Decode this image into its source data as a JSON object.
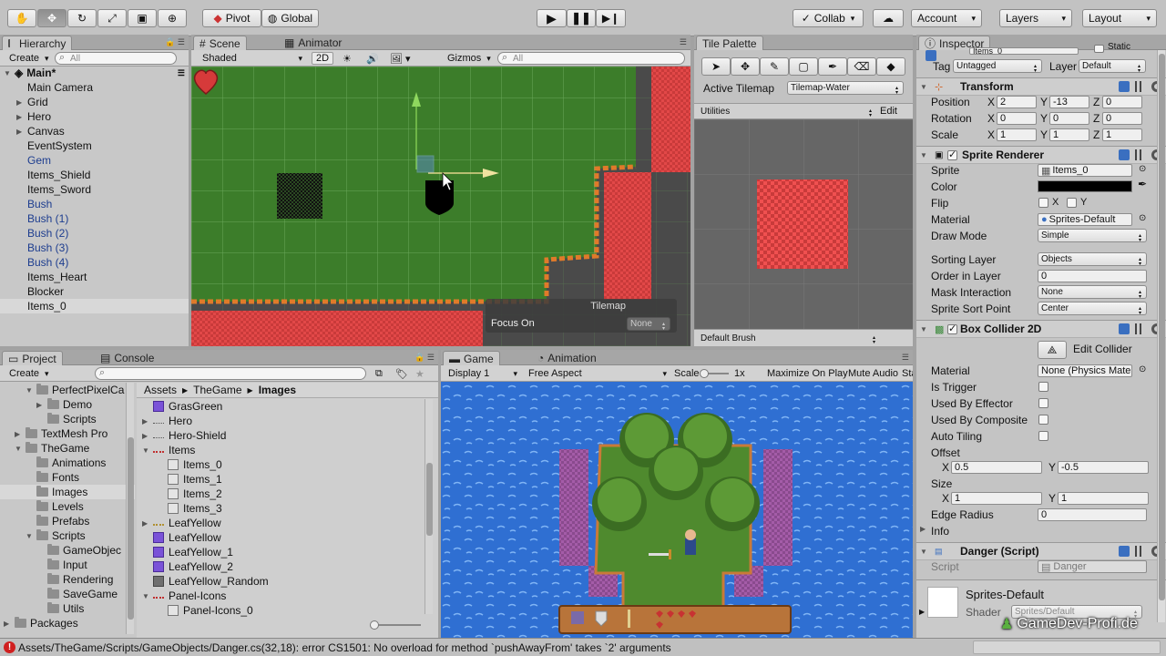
{
  "toolbar": {
    "pivot": "Pivot",
    "global": "Global",
    "collab": "Collab",
    "account": "Account",
    "layers": "Layers",
    "layout": "Layout"
  },
  "hierarchy": {
    "tab": "Hierarchy",
    "create": "Create",
    "search_placeholder": "All",
    "scene": "Main*",
    "items": [
      {
        "label": "Main Camera",
        "arrow": "",
        "color": "normal"
      },
      {
        "label": "Grid",
        "arrow": "▶",
        "color": "normal"
      },
      {
        "label": "Hero",
        "arrow": "▶",
        "color": "normal"
      },
      {
        "label": "Canvas",
        "arrow": "▶",
        "color": "normal"
      },
      {
        "label": "EventSystem",
        "arrow": "",
        "color": "normal"
      },
      {
        "label": "Gem",
        "arrow": "",
        "color": "blue"
      },
      {
        "label": "Items_Shield",
        "arrow": "",
        "color": "normal"
      },
      {
        "label": "Items_Sword",
        "arrow": "",
        "color": "normal"
      },
      {
        "label": "Bush",
        "arrow": "",
        "color": "blue"
      },
      {
        "label": "Bush (1)",
        "arrow": "",
        "color": "blue"
      },
      {
        "label": "Bush (2)",
        "arrow": "",
        "color": "blue"
      },
      {
        "label": "Bush (3)",
        "arrow": "",
        "color": "blue"
      },
      {
        "label": "Bush (4)",
        "arrow": "",
        "color": "blue"
      },
      {
        "label": "Items_Heart",
        "arrow": "",
        "color": "normal"
      },
      {
        "label": "Blocker",
        "arrow": "",
        "color": "normal"
      },
      {
        "label": "Items_0",
        "arrow": "",
        "color": "normal"
      }
    ]
  },
  "scene": {
    "tab_scene": "Scene",
    "tab_animator": "Animator",
    "shading": "Shaded",
    "mode_2d": "2D",
    "gizmos": "Gizmos",
    "search_placeholder": "All",
    "overlay_title": "Tilemap",
    "overlay_focus_label": "Focus On",
    "overlay_focus_value": "None"
  },
  "tile_palette": {
    "tab": "Tile Palette",
    "active_tilemap_label": "Active Tilemap",
    "active_tilemap_value": "Tilemap-Water",
    "palette": "Utilities",
    "edit": "Edit",
    "brush": "Default Brush"
  },
  "inspector": {
    "tab": "Inspector",
    "object_name": "Items_0",
    "static": "Static",
    "tag_label": "Tag",
    "tag_value": "Untagged",
    "layer_label": "Layer",
    "layer_value": "Default",
    "transform": {
      "title": "Transform",
      "position_label": "Position",
      "position": [
        "2",
        "-13",
        "0"
      ],
      "rotation_label": "Rotation",
      "rotation": [
        "0",
        "0",
        "0"
      ],
      "scale_label": "Scale",
      "scale": [
        "1",
        "1",
        "1"
      ]
    },
    "sprite_renderer": {
      "title": "Sprite Renderer",
      "sprite_label": "Sprite",
      "sprite_value": "Items_0",
      "color_label": "Color",
      "color_value": "#000000",
      "flip_label": "Flip",
      "flip_x": "X",
      "flip_y": "Y",
      "material_label": "Material",
      "material_value": "Sprites-Default",
      "draw_mode_label": "Draw Mode",
      "draw_mode_value": "Simple",
      "sorting_layer_label": "Sorting Layer",
      "sorting_layer_value": "Objects",
      "order_label": "Order in Layer",
      "order_value": "0",
      "mask_label": "Mask Interaction",
      "mask_value": "None",
      "sort_point_label": "Sprite Sort Point",
      "sort_point_value": "Center"
    },
    "box_collider": {
      "title": "Box Collider 2D",
      "edit_collider": "Edit Collider",
      "material_label": "Material",
      "material_value": "None (Physics Material 2D)",
      "is_trigger_label": "Is Trigger",
      "effector_label": "Used By Effector",
      "composite_label": "Used By Composite",
      "auto_tiling_label": "Auto Tiling",
      "offset_label": "Offset",
      "offset_x": "0.5",
      "offset_y": "-0.5",
      "size_label": "Size",
      "size_x": "1",
      "size_y": "1",
      "edge_radius_label": "Edge Radius",
      "edge_radius_value": "0",
      "info_label": "Info"
    },
    "danger_script": {
      "title": "Danger (Script)",
      "script_label": "Script",
      "script_value": "Danger"
    },
    "material": {
      "name": "Sprites-Default",
      "shader_label": "Shader",
      "shader_value": "Sprites/Default"
    },
    "axis_x": "X",
    "axis_y": "Y",
    "axis_z": "Z"
  },
  "project": {
    "tab_project": "Project",
    "tab_console": "Console",
    "create": "Create",
    "tree": [
      {
        "label": "PerfectPixelCa",
        "indent": 2,
        "arrow": "▼"
      },
      {
        "label": "Demo",
        "indent": 3,
        "arrow": "▶"
      },
      {
        "label": "Scripts",
        "indent": 3,
        "arrow": ""
      },
      {
        "label": "TextMesh Pro",
        "indent": 1,
        "arrow": "▶"
      },
      {
        "label": "TheGame",
        "indent": 1,
        "arrow": "▼"
      },
      {
        "label": "Animations",
        "indent": 2,
        "arrow": ""
      },
      {
        "label": "Fonts",
        "indent": 2,
        "arrow": ""
      },
      {
        "label": "Images",
        "indent": 2,
        "arrow": "",
        "sel": true
      },
      {
        "label": "Levels",
        "indent": 2,
        "arrow": ""
      },
      {
        "label": "Prefabs",
        "indent": 2,
        "arrow": ""
      },
      {
        "label": "Scripts",
        "indent": 2,
        "arrow": "▼"
      },
      {
        "label": "GameObjec",
        "indent": 3,
        "arrow": ""
      },
      {
        "label": "Input",
        "indent": 3,
        "arrow": ""
      },
      {
        "label": "Rendering",
        "indent": 3,
        "arrow": ""
      },
      {
        "label": "SaveGame",
        "indent": 3,
        "arrow": ""
      },
      {
        "label": "Utils",
        "indent": 3,
        "arrow": ""
      },
      {
        "label": "Packages",
        "indent": 0,
        "arrow": "▶"
      }
    ],
    "breadcrumb": [
      "Assets",
      "TheGame",
      "Images"
    ],
    "files": [
      {
        "label": "GrasGreen",
        "indent": 0,
        "arrow": "",
        "thumb": "purple"
      },
      {
        "label": "Hero",
        "indent": 0,
        "arrow": "▶",
        "thumb": "line"
      },
      {
        "label": "Hero-Shield",
        "indent": 0,
        "arrow": "▶",
        "thumb": "line"
      },
      {
        "label": "Items",
        "indent": 0,
        "arrow": "▼",
        "thumb": "red"
      },
      {
        "label": "Items_0",
        "indent": 1,
        "arrow": "",
        "thumb": "box"
      },
      {
        "label": "Items_1",
        "indent": 1,
        "arrow": "",
        "thumb": "box"
      },
      {
        "label": "Items_2",
        "indent": 1,
        "arrow": "",
        "thumb": "box"
      },
      {
        "label": "Items_3",
        "indent": 1,
        "arrow": "",
        "thumb": "box"
      },
      {
        "label": "LeafYellow",
        "indent": 0,
        "arrow": "▶",
        "thumb": "yellow"
      },
      {
        "label": "LeafYellow",
        "indent": 0,
        "arrow": "",
        "thumb": "purple"
      },
      {
        "label": "LeafYellow_1",
        "indent": 0,
        "arrow": "",
        "thumb": "purple"
      },
      {
        "label": "LeafYellow_2",
        "indent": 0,
        "arrow": "",
        "thumb": "purple"
      },
      {
        "label": "LeafYellow_Random",
        "indent": 0,
        "arrow": "",
        "thumb": "gray"
      },
      {
        "label": "Panel-Icons",
        "indent": 0,
        "arrow": "▼",
        "thumb": "red"
      },
      {
        "label": "Panel-Icons_0",
        "indent": 1,
        "arrow": "",
        "thumb": "box"
      }
    ]
  },
  "game": {
    "tab_game": "Game",
    "tab_animation": "Animation",
    "display": "Display 1",
    "aspect": "Free Aspect",
    "scale_label": "Scale",
    "scale_value": "1x",
    "maximize": "Maximize On Play",
    "mute": "Mute Audio",
    "stats": "Stats"
  },
  "status": {
    "error": "Assets/TheGame/Scripts/GameObjects/Danger.cs(32,18): error CS1501: No overload for method `pushAwayFrom' takes `2' arguments"
  },
  "watermark": "GameDev-Profi.de",
  "colors": {
    "grass": "#3c7d2a",
    "hazard": "#c83a3a",
    "water": "#2f6fd2",
    "selection_blue": "#1d3d8f",
    "error_red": "#d02020"
  }
}
